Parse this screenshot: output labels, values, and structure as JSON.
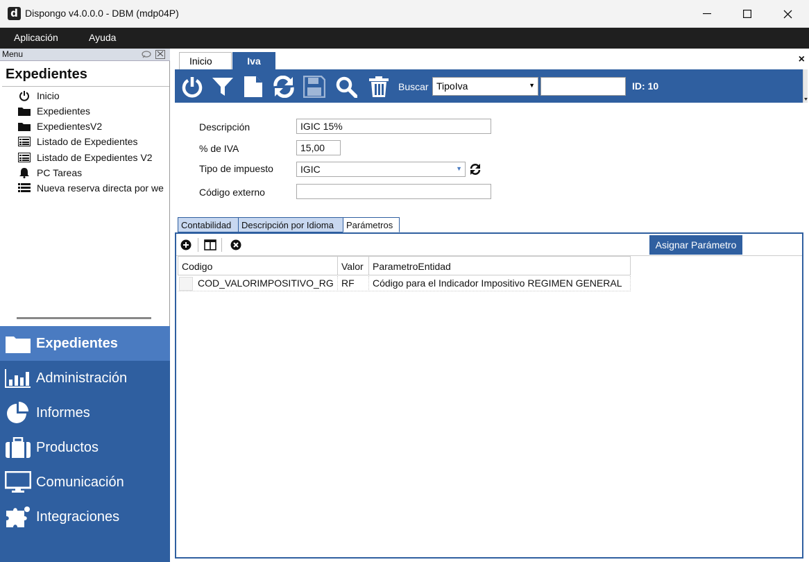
{
  "window": {
    "title": "Dispongo v4.0.0.0 - DBM (mdp04P)",
    "icon_letter": "d",
    "minimize": "—",
    "maximize": "☐",
    "close": "✕"
  },
  "menubar": {
    "items": [
      "Aplicación",
      "Ayuda"
    ]
  },
  "left_panel": {
    "header": "Menu",
    "title": "Expedientes",
    "tree": [
      {
        "label": "Inicio",
        "icon": "power-icon"
      },
      {
        "label": "Expedientes",
        "icon": "folder-icon"
      },
      {
        "label": "ExpedientesV2",
        "icon": "folder-icon"
      },
      {
        "label": "Listado de Expedientes",
        "icon": "list-box-icon"
      },
      {
        "label": "Listado de Expedientes V2",
        "icon": "list-box-icon"
      },
      {
        "label": "PC Tareas",
        "icon": "bell-icon"
      },
      {
        "label": "Nueva reserva directa por we",
        "icon": "list-icon"
      }
    ],
    "nav": [
      {
        "label": "Expedientes",
        "icon": "folder-icon",
        "active": true
      },
      {
        "label": "Administración",
        "icon": "bar-chart-icon",
        "active": false
      },
      {
        "label": "Informes",
        "icon": "pie-chart-icon",
        "active": false
      },
      {
        "label": "Productos",
        "icon": "briefcase-icon",
        "active": false
      },
      {
        "label": "Comunicación",
        "icon": "monitor-icon",
        "active": false
      },
      {
        "label": "Integraciones",
        "icon": "puzzle-icon",
        "active": false
      }
    ]
  },
  "doc_tabs": {
    "inicio": "Inicio",
    "iva": "Iva",
    "close": "×"
  },
  "toolbar": {
    "buscar_label": "Buscar",
    "search_field": "TipoIva",
    "search_value": "",
    "id_label": "ID: 10"
  },
  "form": {
    "descripcion_label": "Descripción",
    "descripcion_value": "IGIC 15%",
    "iva_label": "% de IVA",
    "iva_value": "15,00",
    "tipo_label": "Tipo de impuesto",
    "tipo_value": "IGIC",
    "codigo_label": "Código externo",
    "codigo_value": ""
  },
  "sub_tabs": [
    "Contabilidad",
    "Descripción por Idioma",
    "Parámetros"
  ],
  "grid": {
    "assign_button": "Asignar Parámetro",
    "columns": [
      "Codigo",
      "Valor",
      "ParametroEntidad"
    ],
    "rows": [
      [
        "COD_VALORIMPOSITIVO_RG",
        "RF",
        "Código para el Indicador Impositivo REGIMEN GENERAL"
      ]
    ]
  },
  "colors": {
    "accent": "#2f5fa0",
    "accent_light": "#4a7bc1",
    "menubar": "#1f1f1f"
  }
}
